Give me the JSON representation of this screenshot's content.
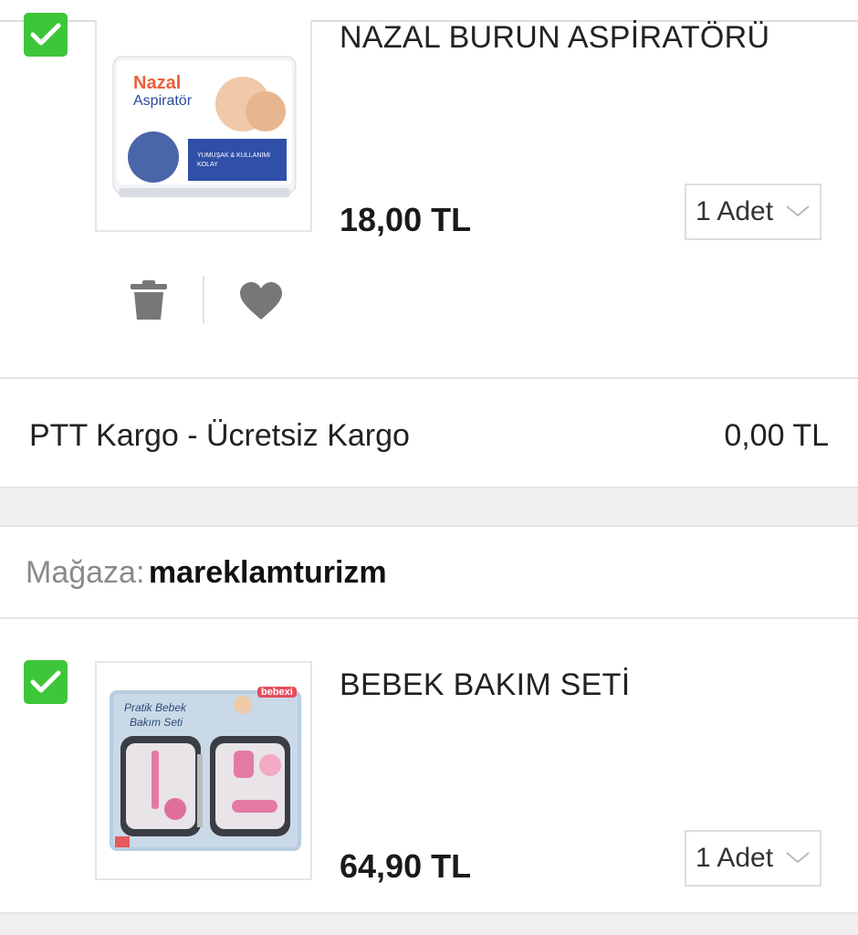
{
  "items": [
    {
      "title": "NAZAL BURUN ASPİRATÖRÜ",
      "price": "18,00 TL",
      "quantity": "1 Adet",
      "image": {
        "brand": "Nazal",
        "product": "Aspiratör",
        "badge": "YUMUŞAK & KULLANIMI KOLAY"
      }
    },
    {
      "title": "BEBEK BAKIM SETİ",
      "price": "64,90 TL",
      "quantity": "1 Adet",
      "image": {
        "line1": "Pratik Bebek",
        "line2": "Bakım Seti",
        "brand": "bebexi"
      }
    }
  ],
  "shipping": {
    "label": "PTT Kargo - Ücretsiz Kargo",
    "cost": "0,00 TL"
  },
  "store": {
    "prefix": "Mağaza:",
    "name": "mareklamturizm"
  },
  "icons": {
    "checkbox": "check-icon",
    "delete": "trash-icon",
    "favorite": "heart-icon",
    "dropdown": "chevron-down-icon"
  },
  "colors": {
    "check_green": "#3ec63b",
    "divider": "#e4e4e4",
    "section_gray": "#efefef",
    "icon_gray": "#777777"
  }
}
